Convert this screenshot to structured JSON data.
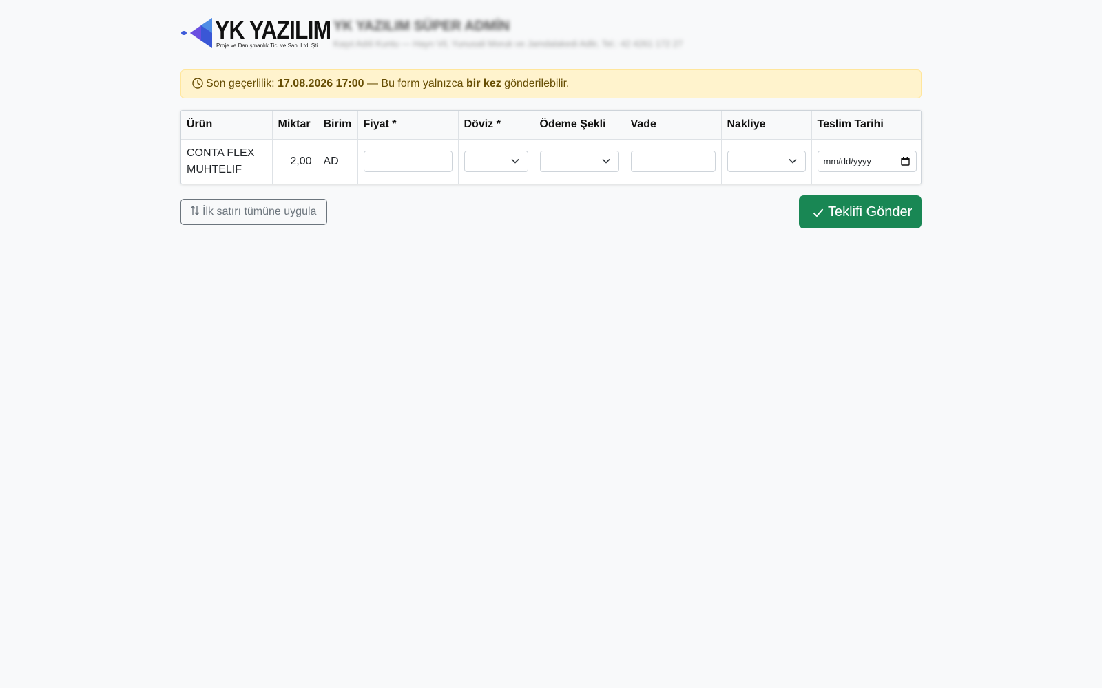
{
  "brand": {
    "logo_title": "YK YAZILIM",
    "logo_subtitle": "Proje ve Danışmanlık Tic. ve San. Ltd. Şti.",
    "company_name": "YK YAZILIM SÜPER ADMİN",
    "company_info": "Kaşıt Adıli Kuntu — Hayrı Vil, Yunusali Moruk ve Jamdalakedi Adlir, Tel.: 42 4261 172 27",
    "accent_color": "#3d5bd9"
  },
  "alert": {
    "prefix": "Son geçerlilik:",
    "deadline": "17.08.2026 17:00",
    "middle": "— Bu form yalnızca",
    "emphasis": "bir kez",
    "suffix": "gönderilebilir.",
    "icon": "clock-icon"
  },
  "table": {
    "headers": {
      "product": "Ürün",
      "quantity": "Miktar",
      "unit": "Birim",
      "price": "Fiyat *",
      "currency": "Döviz *",
      "payment": "Ödeme Şekli",
      "term": "Vade",
      "shipping": "Nakliye",
      "delivery": "Teslim Tarihi"
    },
    "rows": [
      {
        "product": "CONTA FLEX MUHTELIF",
        "quantity": "2,00",
        "unit": "AD",
        "price": "",
        "currency": "—",
        "payment": "—",
        "term": "",
        "shipping": "—",
        "delivery_placeholder": "mm/dd/yyyy"
      }
    ]
  },
  "actions": {
    "apply_first_row": "İlk satırı tümüne uygula",
    "submit": "Teklifi Gönder",
    "submit_color": "#198754"
  }
}
